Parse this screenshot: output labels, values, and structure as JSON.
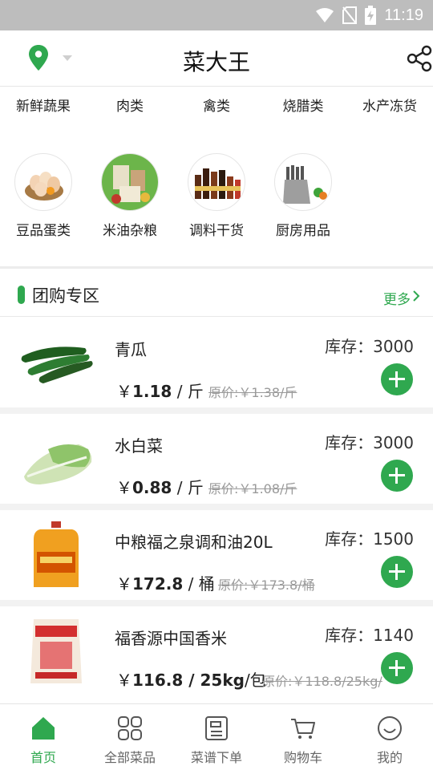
{
  "status_bar": {
    "time": "11:19"
  },
  "header": {
    "title": "菜大王"
  },
  "categories": {
    "row1": [
      {
        "label": "新鲜蔬果"
      },
      {
        "label": "肉类"
      },
      {
        "label": "禽类"
      },
      {
        "label": "烧腊类"
      },
      {
        "label": "水产冻货"
      }
    ],
    "row2": [
      {
        "label": "豆品蛋类"
      },
      {
        "label": "米油杂粮"
      },
      {
        "label": "调料干货"
      },
      {
        "label": "厨房用品"
      }
    ]
  },
  "group_buy": {
    "title": "团购专区",
    "more_label": "更多",
    "items": [
      {
        "name": "青瓜",
        "stock": "库存：3000",
        "price_symbol": "￥",
        "price": "1.18",
        "unit": " / 斤",
        "original": "原价:￥1.38/斤"
      },
      {
        "name": "水白菜",
        "stock": "库存：3000",
        "price_symbol": "￥",
        "price": "0.88",
        "unit": " / 斤",
        "original": "原价:￥1.08/斤"
      },
      {
        "name": "中粮福之泉调和油20L",
        "stock": "库存：1500",
        "price_symbol": "￥",
        "price": "172.8",
        "unit": " / 桶",
        "original": "原价:￥173.8/桶"
      },
      {
        "name": "福香源中国香米",
        "stock": "库存：1140",
        "price_symbol": "￥",
        "price": "116.8 / 25kg",
        "unit": "/包",
        "original": "原价:￥118.8/25kg/"
      }
    ]
  },
  "tabbar": {
    "tabs": [
      {
        "label": "首页",
        "icon": "home-icon",
        "active": true
      },
      {
        "label": "全部菜品",
        "icon": "grid-icon",
        "active": false
      },
      {
        "label": "菜谱下单",
        "icon": "recipe-icon",
        "active": false
      },
      {
        "label": "购物车",
        "icon": "cart-icon",
        "active": false
      },
      {
        "label": "我的",
        "icon": "smile-icon",
        "active": false
      }
    ]
  },
  "colors": {
    "accent": "#2fa84f",
    "status_bar": "#bdbdbd"
  }
}
